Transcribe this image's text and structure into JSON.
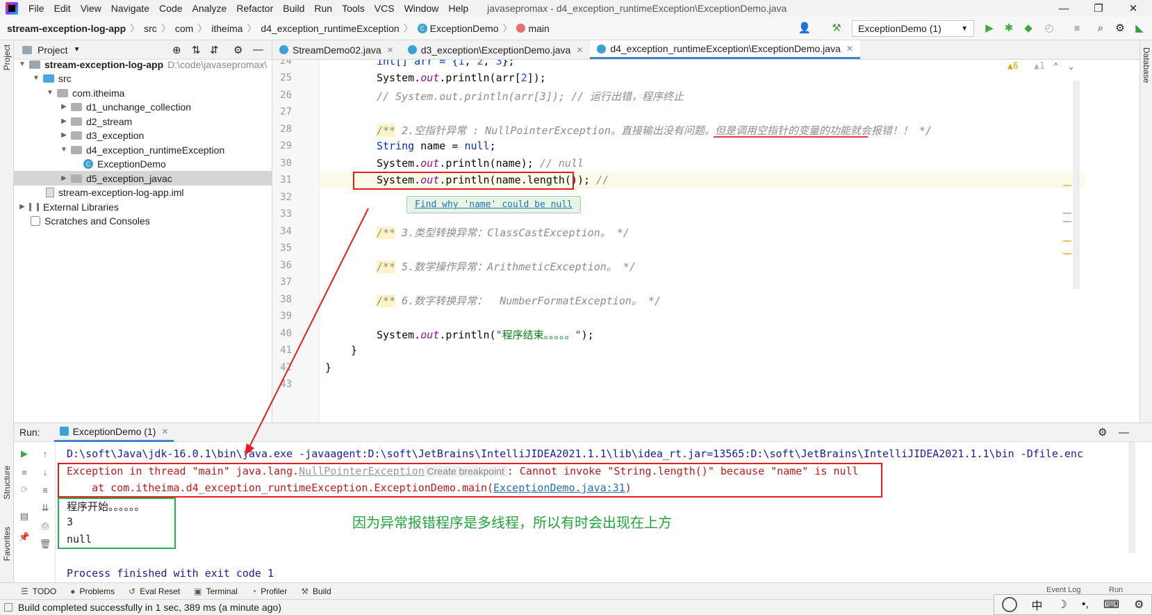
{
  "menubar": {
    "items": [
      "File",
      "Edit",
      "View",
      "Navigate",
      "Code",
      "Analyze",
      "Refactor",
      "Build",
      "Run",
      "Tools",
      "VCS",
      "Window",
      "Help"
    ],
    "window_title": "javasepromax - d4_exception_runtimeException\\ExceptionDemo.java",
    "minimize": "—",
    "restore": "❐",
    "close": "✕"
  },
  "navbar": {
    "crumbs": [
      "stream-exception-log-app",
      "src",
      "com",
      "itheima",
      "d4_exception_runtimeException",
      "ExceptionDemo",
      "main"
    ],
    "sep": "〉",
    "run_config": "ExceptionDemo (1)"
  },
  "stripes": {
    "project": "Project",
    "structure": "Structure",
    "favorites": "Favorites",
    "database": "Database"
  },
  "project": {
    "header": "Project",
    "tree": [
      {
        "label": "stream-exception-log-app",
        "path": "D:\\code\\javasepromax\\"
      },
      {
        "label": "src"
      },
      {
        "label": "com.itheima"
      },
      {
        "label": "d1_unchange_collection"
      },
      {
        "label": "d2_stream"
      },
      {
        "label": "d3_exception"
      },
      {
        "label": "d4_exception_runtimeException"
      },
      {
        "label": "ExceptionDemo"
      },
      {
        "label": "d5_exception_javac"
      },
      {
        "label": "stream-exception-log-app.iml"
      },
      {
        "label": "External Libraries"
      },
      {
        "label": "Scratches and Consoles"
      }
    ]
  },
  "tabs": [
    {
      "label": "StreamDemo02.java"
    },
    {
      "label": "d3_exception\\ExceptionDemo.java"
    },
    {
      "label": "d4_exception_runtimeException\\ExceptionDemo.java"
    }
  ],
  "editor": {
    "warnings": "▲6",
    "weak_warnings": "▲1",
    "line_numbers": [
      "24",
      "25",
      "26",
      "27",
      "28",
      "29",
      "30",
      "31",
      "32",
      "33",
      "34",
      "35",
      "36",
      "37",
      "38",
      "39",
      "40",
      "41",
      "42",
      "43"
    ],
    "lines": {
      "l24_a": "int[] arr = {",
      "l24_n1": "1",
      "l24_c1": ", ",
      "l24_n2": "2",
      "l24_c2": ", ",
      "l24_n3": "3",
      "l24_end": "};",
      "l25_a": "System.",
      "l25_out": "out",
      "l25_b": ".println(arr[",
      "l25_n": "2",
      "l25_c": "]);",
      "l26": "// System.out.println(arr[3]); // 运行出错，程序终止",
      "l28_mark": "/**",
      "l28_text": " 2.空指针异常 : NullPointerException。直接输出没有问题。但是调用空指针的变量的功能就会报错！！ */",
      "l29_kw": "String",
      "l29_name": " name = ",
      "l29_null": "null",
      "l29_end": ";",
      "l30_a": "System.",
      "l30_out": "out",
      "l30_b": ".println(name); ",
      "l30_cm": "// null",
      "l31_a": "System.",
      "l31_out": "out",
      "l31_b": ".println(name.length());",
      "l31_cm": " //",
      "l34_mark": "/**",
      "l34_text": " 3.类型转换异常：ClassCastException。 */",
      "l36_mark": "/**",
      "l36_text": " 5.数学操作异常：ArithmeticException。 */",
      "l38_mark": "/**",
      "l38_text": " 6.数字转换异常：  NumberFormatException。 */",
      "l40_a": "System.",
      "l40_out": "out",
      "l40_b": ".println(",
      "l40_str": "\"程序结束。。。。。\"",
      "l40_end": ");",
      "l41": "}",
      "l42": "}"
    },
    "tooltip": "Find why 'name' could be null"
  },
  "run": {
    "label": "Run:",
    "tab": "ExceptionDemo (1)",
    "console": {
      "cmd": "D:\\soft\\Java\\jdk-16.0.1\\bin\\java.exe -javaagent:D:\\soft\\JetBrains\\IntelliJIDEA2021.1.1\\lib\\idea_rt.jar=13565:D:\\soft\\JetBrains\\IntelliJIDEA2021.1.1\\bin -Dfile.enc",
      "err1_a": "Exception in thread \"main\" java.lang.",
      "err1_npe": "NullPointerException",
      "err1_bp": " Create breakpoint ",
      "err1_b": ": Cannot invoke \"String.length()\" because \"name\" is null",
      "err2_a": "    at com.itheima.d4_exception_runtimeException.ExceptionDemo.main(",
      "err2_link": "ExceptionDemo.java:31",
      "err2_b": ")",
      "out1": "程序开始。。。。。。",
      "out2": "3",
      "out3": "null",
      "finish": "Process finished with exit code 1"
    },
    "annotation": "因为异常报错程序是多线程，所以有时会出现在上方"
  },
  "bottom_tools": [
    {
      "icon": "☰",
      "label": "TODO"
    },
    {
      "icon": "●",
      "label": "Problems"
    },
    {
      "icon": "↺",
      "label": "Eval Reset"
    },
    {
      "icon": "▣",
      "label": "Terminal"
    },
    {
      "icon": "◔",
      "label": "Profiler"
    },
    {
      "icon": "⚒",
      "label": "Build"
    }
  ],
  "bottom_right": {
    "event_log": "Event Log",
    "run": "Run"
  },
  "status": {
    "text": "Build completed successfully in 1 sec, 389 ms (a minute ago)"
  },
  "ime": {
    "chars": [
      "中",
      "☽",
      "•,",
      "⌨",
      "⚙"
    ]
  },
  "colors": {
    "annotation_red": "#e81c1c",
    "annotation_green": "#22b14c",
    "active_tab": "#4083c9",
    "error_text": "#c21818"
  }
}
